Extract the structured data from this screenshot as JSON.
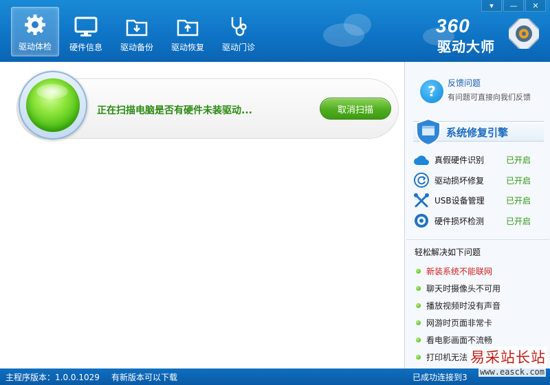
{
  "window_controls": {
    "menu": "▾",
    "minimize": "—",
    "close": "✕"
  },
  "nav": {
    "items": [
      {
        "label": "驱动体检",
        "icon": "gear-icon",
        "active": true
      },
      {
        "label": "硬件信息",
        "icon": "monitor-icon",
        "active": false
      },
      {
        "label": "驱动备份",
        "icon": "folder-download-icon",
        "active": false
      },
      {
        "label": "驱动恢复",
        "icon": "folder-upload-icon",
        "active": false
      },
      {
        "label": "驱动门诊",
        "icon": "stethoscope-icon",
        "active": false
      }
    ]
  },
  "logo": {
    "number": "360",
    "name": "驱动大师"
  },
  "scan": {
    "status_text": "正在扫描电脑是否有硬件未装驱动...",
    "cancel_label": "取消扫描"
  },
  "side": {
    "feedback": {
      "title": "反馈问题",
      "subtitle": "有问题可直接向我们反馈"
    },
    "engine_title": "系统修复引擎",
    "features": [
      {
        "label": "真假硬件识别",
        "status": "已开启",
        "icon": "cloud-icon"
      },
      {
        "label": "驱动损坏修复",
        "status": "已开启",
        "icon": "refresh-icon"
      },
      {
        "label": "USB设备管理",
        "status": "已开启",
        "icon": "tools-icon"
      },
      {
        "label": "硬件损坏检测",
        "status": "已开启",
        "icon": "gear-check-icon"
      }
    ],
    "solve_title": "轻松解决如下问题",
    "problems": [
      {
        "text": "新装系统不能联网",
        "highlight": true
      },
      {
        "text": "聊天时摄像头不可用",
        "highlight": false
      },
      {
        "text": "播放视频时没有声音",
        "highlight": false
      },
      {
        "text": "网游时页面非常卡",
        "highlight": false
      },
      {
        "text": "看电影画面不流畅",
        "highlight": false
      },
      {
        "text": "打印机无法",
        "highlight": false
      }
    ]
  },
  "statusbar": {
    "version": "主程序版本：1.0.0.1029",
    "update": "有新版本可以下载",
    "right": "已成功连接到3"
  },
  "watermark": {
    "text": "易采站长站",
    "url": "www.easck.com"
  },
  "colors": {
    "header": "#0f75c6",
    "accent_green": "#2f9a14",
    "highlight_red": "#d02020"
  }
}
